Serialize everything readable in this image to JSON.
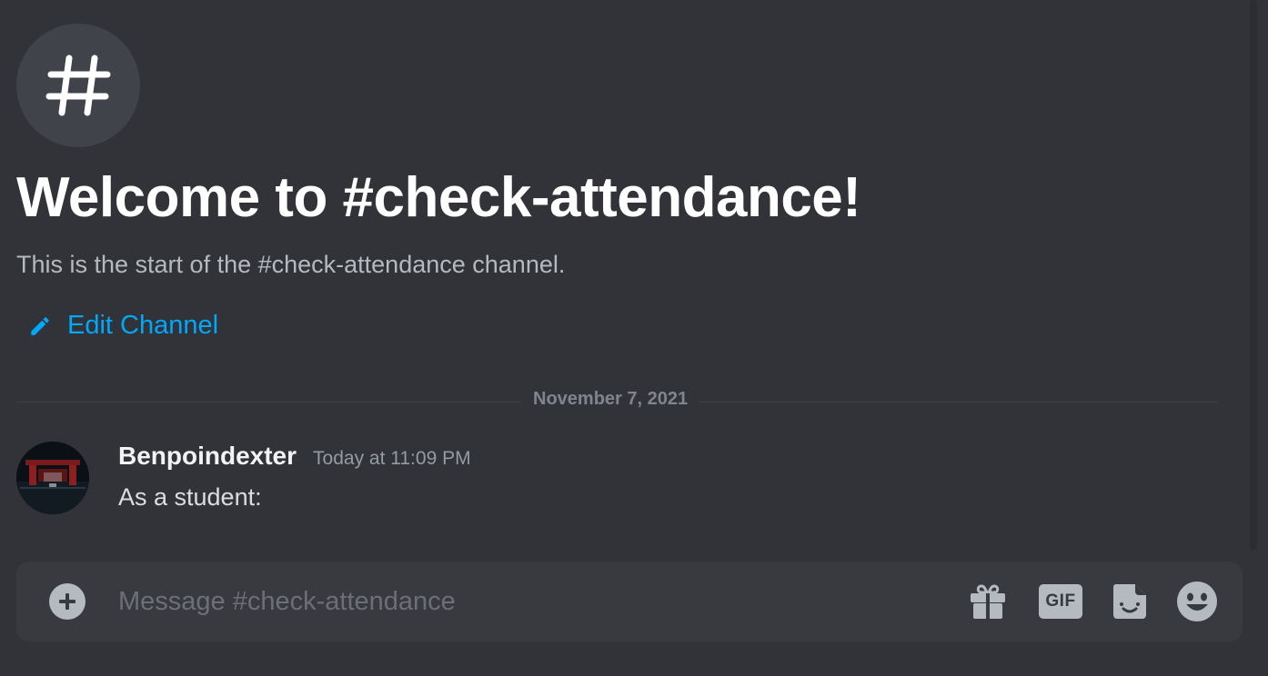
{
  "channel": {
    "icon": "hash-icon",
    "welcome_title": "Welcome to #check-attendance!",
    "subtitle": "This is the start of the #check-attendance channel.",
    "edit_label": "Edit Channel"
  },
  "divider": {
    "date": "November 7, 2021"
  },
  "messages": [
    {
      "username": "Benpoindexter",
      "timestamp": "Today at 11:09 PM",
      "content": "As a student:",
      "avatar": "avatar-image"
    }
  ],
  "composer": {
    "placeholder": "Message #check-attendance",
    "value": "",
    "gif_label": "GIF",
    "icons": [
      "plus-circle-icon",
      "gift-icon",
      "gif-icon",
      "sticker-icon",
      "emoji-icon"
    ]
  },
  "colors": {
    "background": "#313338",
    "composer_bg": "#383a40",
    "link": "#00a8fc",
    "title": "#ffffff",
    "muted": "#b5bac1"
  }
}
